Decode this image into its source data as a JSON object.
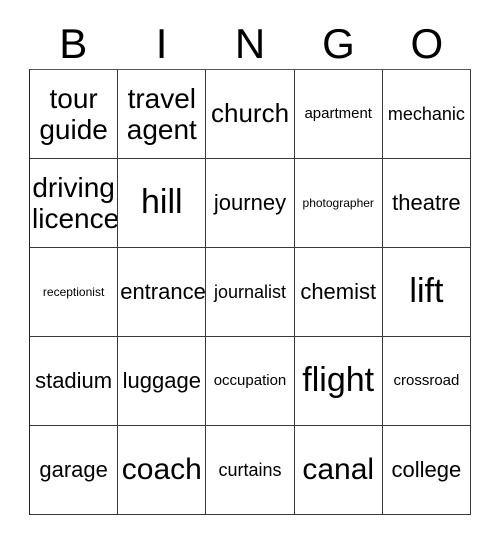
{
  "card": {
    "title": "BINGO",
    "header_letters": [
      "B",
      "I",
      "N",
      "G",
      "O"
    ],
    "columns": 5,
    "rows": 5,
    "colors": {
      "background": "#ffffff",
      "text": "#000000",
      "grid_line": "#3a3a3a"
    },
    "grid": [
      [
        {
          "text": "tour\nguide",
          "size": "two-line"
        },
        {
          "text": "travel\nagent",
          "size": "two-line"
        },
        {
          "text": "church",
          "size": "size-lg"
        },
        {
          "text": "apartment",
          "size": "size-xs"
        },
        {
          "text": "mechanic",
          "size": "size-sm"
        }
      ],
      [
        {
          "text": "driving\nlicence",
          "size": "two-line"
        },
        {
          "text": "hill",
          "size": "size-xxl"
        },
        {
          "text": "journey",
          "size": "size-md"
        },
        {
          "text": "photographer",
          "size": "size-xxs"
        },
        {
          "text": "theatre",
          "size": "size-md"
        }
      ],
      [
        {
          "text": "receptionist",
          "size": "size-xxs"
        },
        {
          "text": "entrance",
          "size": "size-md"
        },
        {
          "text": "journalist",
          "size": "size-sm"
        },
        {
          "text": "chemist",
          "size": "size-md"
        },
        {
          "text": "lift",
          "size": "size-xxl"
        }
      ],
      [
        {
          "text": "stadium",
          "size": "size-md"
        },
        {
          "text": "luggage",
          "size": "size-md"
        },
        {
          "text": "occupation",
          "size": "size-xs"
        },
        {
          "text": "flight",
          "size": "size-xxl"
        },
        {
          "text": "crossroad",
          "size": "size-xs"
        }
      ],
      [
        {
          "text": "garage",
          "size": "size-md"
        },
        {
          "text": "coach",
          "size": "size-xl"
        },
        {
          "text": "curtains",
          "size": "size-sm"
        },
        {
          "text": "canal",
          "size": "size-xl"
        },
        {
          "text": "college",
          "size": "size-md"
        }
      ]
    ]
  }
}
